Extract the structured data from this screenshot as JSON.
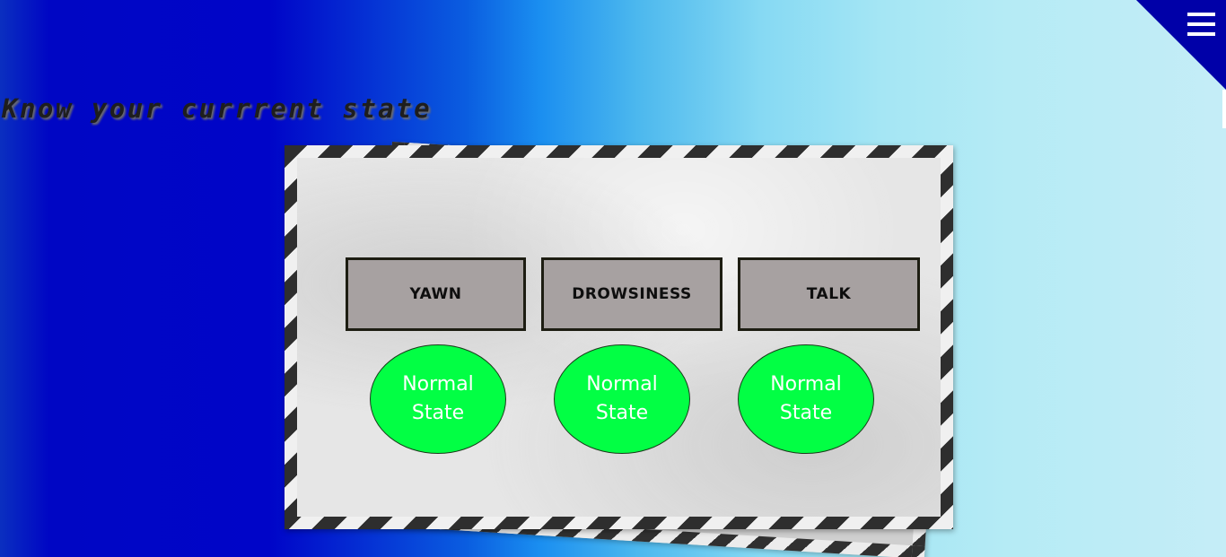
{
  "header": {
    "title": "Know your currrent state",
    "menu_icon": "hamburger-menu-icon"
  },
  "states": [
    {
      "label": "YAWN",
      "status": "Normal State"
    },
    {
      "label": "DROWSINESS",
      "status": "Normal State"
    },
    {
      "label": "TALK",
      "status": "Normal State"
    }
  ],
  "colors": {
    "status_normal": "#02ff44",
    "label_box": "#a7a1a1",
    "menu_corner": "#0000a8"
  }
}
